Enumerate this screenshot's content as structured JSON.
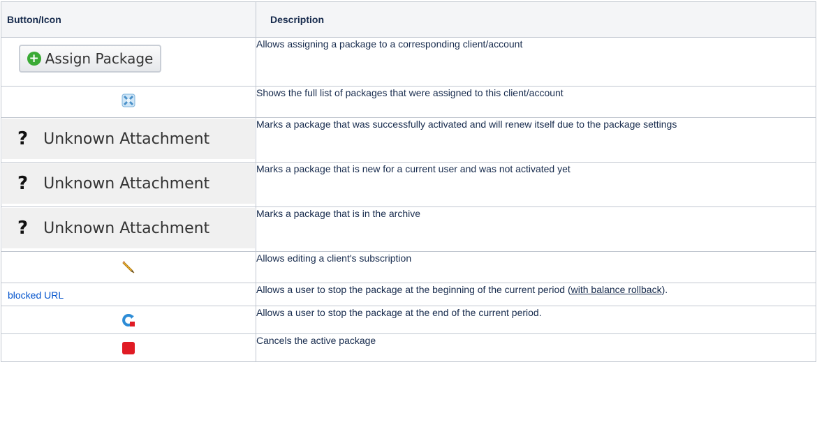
{
  "header": {
    "col1": "Button/Icon",
    "col2": "Description"
  },
  "rows": [
    {
      "icon": "assign-package-button",
      "button_label": "Assign Package",
      "description": "Allows assigning a package to a corresponding client/account"
    },
    {
      "icon": "package-list-icon",
      "description": "Shows the full list of packages that were assigned to this client/account"
    },
    {
      "icon": "unknown-attachment",
      "attachment_label": "Unknown Attachment",
      "description": "Marks a package that was successfully activated and will renew itself due to the package settings"
    },
    {
      "icon": "unknown-attachment",
      "attachment_label": "Unknown Attachment",
      "description": "Marks a package that is new for a current user and was not activated yet"
    },
    {
      "icon": "unknown-attachment",
      "attachment_label": "Unknown Attachment",
      "description": "Marks a package that is in the archive"
    },
    {
      "icon": "pencil-icon",
      "description": "Allows editing a client's subscription"
    },
    {
      "icon": "blocked-url-link",
      "link_text": "blocked URL",
      "description_prefix": "Allows a user to stop the package at the beginning of the current period (",
      "description_link": "with balance rollback",
      "description_suffix": ")."
    },
    {
      "icon": "stop-at-end-icon",
      "description": "Allows a user to stop the package at the end of the current period."
    },
    {
      "icon": "stop-icon",
      "description": "Cancels the active package"
    }
  ],
  "colors": {
    "border": "#c1c7d0",
    "header_bg": "#f4f5f7",
    "link": "#0052cc",
    "plus_green": "#3aaa35",
    "stop_red": "#e01b24",
    "refresh_blue": "#2d8cd6"
  },
  "icon_question_mark": "?",
  "icon_plus": "+"
}
